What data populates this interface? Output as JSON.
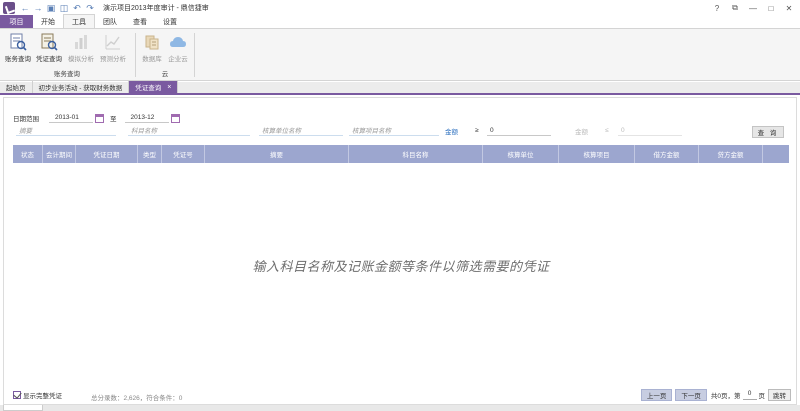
{
  "window": {
    "title": "演示项目2013年度审计 - 鼎信捷审",
    "colors": {
      "accent": "#7a5aa0",
      "table_header": "#9ca6cf",
      "link": "#2b6fbf"
    }
  },
  "quick_access": [
    "back-icon",
    "forward-icon",
    "save-icon",
    "save-all-icon",
    "undo-icon",
    "redo-icon"
  ],
  "ribbon": {
    "tabs": [
      {
        "label": "项目"
      },
      {
        "label": "开始"
      },
      {
        "label": "工具"
      },
      {
        "label": "团队"
      },
      {
        "label": "查看"
      },
      {
        "label": "设置"
      }
    ],
    "groups": {
      "finance_query": {
        "label": "账务查询",
        "buttons": [
          "账务查询",
          "凭证查询",
          "模拟分析",
          "预测分析"
        ]
      },
      "cloud": {
        "label": "云",
        "buttons": [
          "数据库",
          "企业云"
        ]
      }
    }
  },
  "doc_tabs": [
    "起始页",
    "初步业务活动 - 获取财务数据",
    "凭证查询"
  ],
  "filter": {
    "date_range_label": "日期范围",
    "date_from": "2013-01",
    "to_label": "至",
    "date_to": "2013-12",
    "summary_placeholder": "摘要",
    "account_placeholder": "科目名称",
    "unit_placeholder": "核算单位名称",
    "item_placeholder": "核算项目名称",
    "amount_label": "金额",
    "amount_op": "≥",
    "amount_value": "0",
    "amount_label2": "金额",
    "amount_op2": "≤",
    "amount_value2": "0",
    "query_button": "查 询"
  },
  "table": {
    "columns": [
      "状态",
      "会计期间",
      "凭证日期",
      "类型",
      "凭证号",
      "摘要",
      "科目名称",
      "核算单位",
      "核算项目",
      "借方金额",
      "贷方金额"
    ],
    "empty_message": "输入科目名称及记账金额等条件以筛选需要的凭证"
  },
  "footer": {
    "show_full_label": "显示完整凭证",
    "stats": "总分录数：2,626，符合条件：0",
    "prev_page": "上一页",
    "next_page": "下一页",
    "total_pages_text": "共0页，第",
    "current_page": "0",
    "page_suffix": "页",
    "go_button": "跳转"
  }
}
